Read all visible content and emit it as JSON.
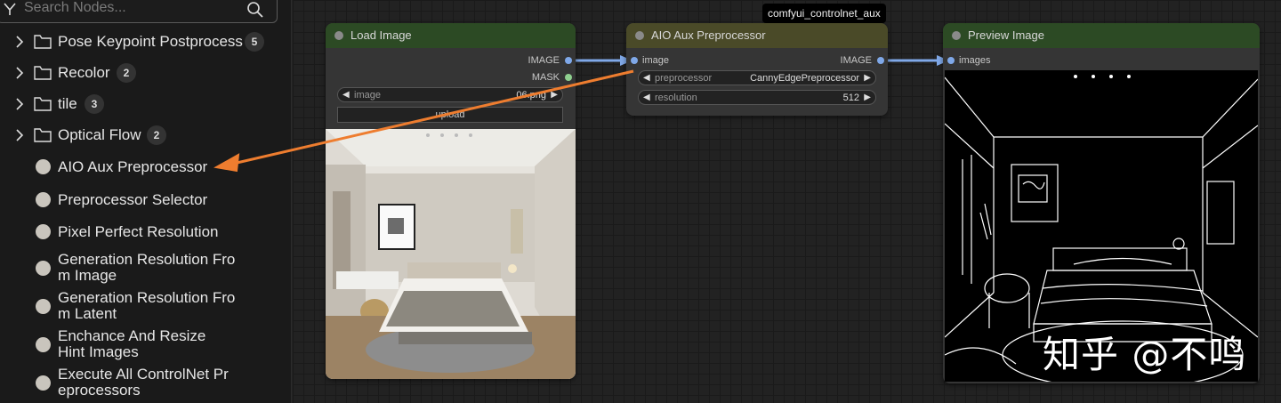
{
  "search": {
    "placeholder": "Search Nodes..."
  },
  "tree": {
    "folders": [
      {
        "label": "Pose Keypoint Postprocess",
        "count": "5"
      },
      {
        "label": "Recolor",
        "count": "2"
      },
      {
        "label": "tile",
        "count": "3"
      },
      {
        "label": "Optical Flow",
        "count": "2"
      }
    ],
    "nodes": [
      "AIO Aux Preprocessor",
      "Preprocessor Selector",
      "Pixel Perfect Resolution",
      "Generation Resolution From Image",
      "Generation Resolution From Latent",
      "Enchance And Resize Hint Images",
      "Execute All ControlNet Preprocessors"
    ]
  },
  "canvas": {
    "pack_badge": "comfyui_controlnet_aux",
    "load_image": {
      "title": "Load Image",
      "outputs": [
        "IMAGE",
        "MASK"
      ],
      "image_label": "image",
      "image_value": "06.png",
      "upload_label": "upload"
    },
    "aio": {
      "title": "AIO Aux Preprocessor",
      "input": "image",
      "output": "IMAGE",
      "preprocessor_label": "preprocessor",
      "preprocessor_value": "CannyEdgePreprocessor",
      "resolution_label": "resolution",
      "resolution_value": "512"
    },
    "preview": {
      "title": "Preview Image",
      "input": "images"
    },
    "watermark": "知乎 @不鸣"
  },
  "colors": {
    "load_header": "#2c4a24",
    "aio_header": "#4a4a28",
    "preview_header": "#2c4a24",
    "image_slot": "#7fa8e8",
    "mask_slot": "#8fd08f",
    "arrow": "#ee7d2f"
  }
}
